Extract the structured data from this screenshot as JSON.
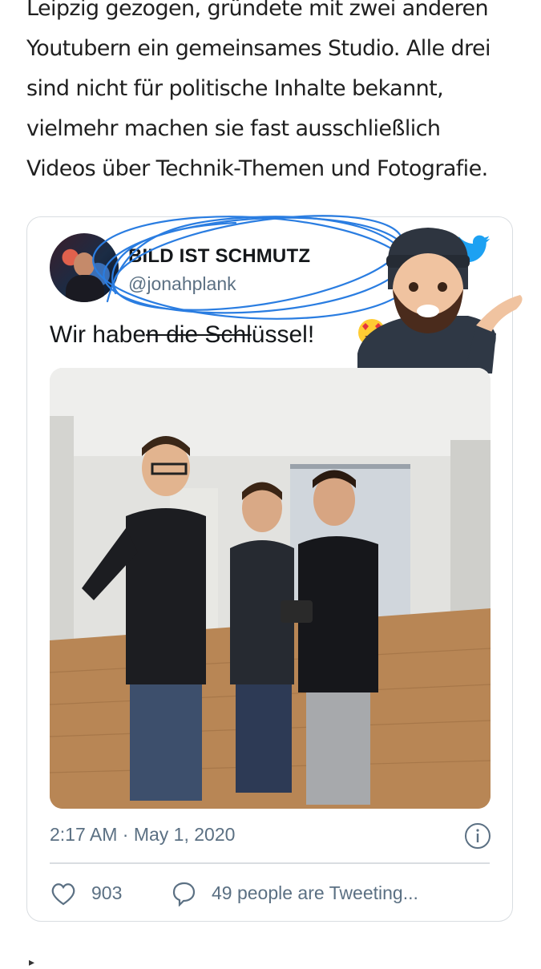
{
  "article": {
    "lines": [
      "Leipzig gezogen, gründete mit zwei anderen",
      "Youtubern ein gemeinsames Studio. Alle drei",
      "sind nicht für politische Inhalte bekannt,",
      "vielmehr machen sie fast ausschließlich",
      "Videos über Technik-Themen und Fotografie."
    ]
  },
  "tweet": {
    "author_name": "BILD IST SCHMUTZ",
    "author_handle": "@jonahplank",
    "text_before": "Wir habe",
    "text_struck": "n die Schl",
    "text_after": "üssel!",
    "timestamp": "2:17 AM · May 1, 2020",
    "like_count": "903",
    "conversation_text": "49 people are Tweeting..."
  },
  "icons": {
    "twitter": "twitter-bird-icon",
    "info": "info-icon",
    "like": "heart-outline-icon",
    "reply": "speech-bubble-icon",
    "emoji": "heart-eyes-emoji-icon"
  },
  "colors": {
    "twitter_blue": "#1da1f2",
    "scribble_blue": "#2a7de1",
    "secondary_text": "#5b7083",
    "card_border": "#d9dde1"
  }
}
